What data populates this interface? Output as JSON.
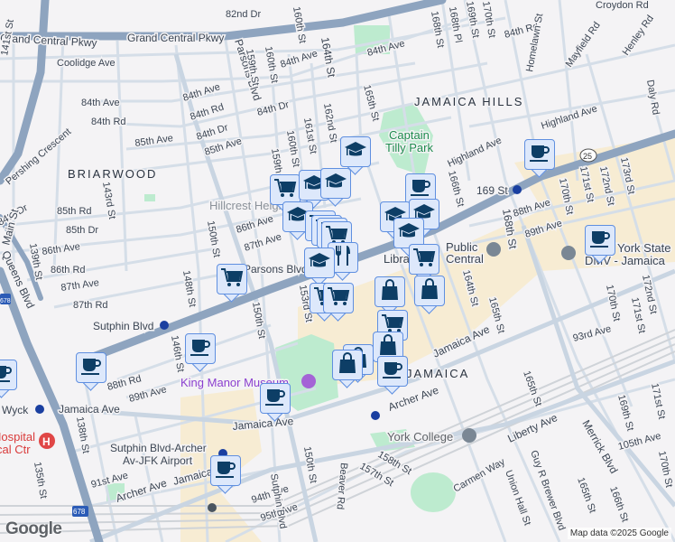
{
  "map": {
    "neighborhoods": {
      "briarwood": "BRIARWOOD",
      "jamaica_hills": "JAMAICA HILLS",
      "jamaica": "JAMAICA",
      "hillcrest": "Hillcrest Heights"
    },
    "parks": {
      "captain_tilly_line1": "Captain",
      "captain_tilly_line2": "Tilly Park"
    },
    "pois": {
      "king_manor": "King Manor Museum",
      "york_college": "York College",
      "library_line1": "Public",
      "library_line2": "Library",
      "library_line3": "Central",
      "dmv_line1": "York State",
      "dmv_line2": "DMV - Jamaica",
      "hospital_line1": "Hospital",
      "hospital_line2": "cal Ctr"
    },
    "stations": {
      "s169": "169 St",
      "sutphin": "Sutphin Blvd",
      "sutphin_archer_1": "Sutphin Blvd-Archer",
      "sutphin_archer_2": "Av-JFK Airport",
      "wyck": "Wyck",
      "jamaica_center": "Jamaica"
    },
    "roads": {
      "gcp1": "Grand Central Pkwy",
      "gcp2": "Grand Central Pkwy",
      "coolidge": "Coolidge Ave",
      "a84_1": "84th Ave",
      "a84_2": "84th Ave",
      "a84_3": "84th Ave",
      "a84_4": "84th Ave",
      "r84_1": "84th Rd",
      "r84_2": "84th Rd",
      "r84_3": "84th Rd",
      "d84_1": "84th Dr",
      "d84_2": "84th Dr",
      "d84_3": "84th Dr",
      "a85": "85th Ave",
      "a85b": "85th Ave",
      "r85": "85th Rd",
      "d85": "85th Dr",
      "a86": "86th Ave",
      "a86b": "86th Ave",
      "r86": "86th Rd",
      "a87": "87th Ave",
      "a87b": "87th Ave",
      "r87": "87th Rd",
      "r88": "88th Rd",
      "a89": "89th Ave",
      "a88e": "88th Ave",
      "a89e": "89th Ave",
      "a93": "93rd Ave",
      "a91": "91st Ave",
      "a94": "94th Ave",
      "a95": "95th Ave",
      "a105": "105th Ave",
      "parsons": "Parsons Blvd",
      "parsons2": "Parsons Blvd",
      "pershing": "Pershing Crescent",
      "highland1": "Highland Ave",
      "highland2": "Highland Ave",
      "homelawn": "Homelawn St",
      "mayfield": "Mayfield Rd",
      "henley": "Henley Rd",
      "daly": "Daly Rd",
      "croydon": "Croydon Rd",
      "d82": "82nd Dr",
      "jamaica1": "Jamaica Ave",
      "jamaica2": "Jamaica Ave",
      "jamaica3": "Jamaica Ave",
      "archer1": "Archer Ave",
      "archer2": "Archer Ave",
      "liberty": "Liberty Ave",
      "merrick": "Merrick Blvd",
      "guy": "Guy R Brewer Blvd",
      "union": "Union Hall St",
      "sutphin_blvd": "Sutphin Blvd",
      "beaver": "Beaver Rd",
      "carmen": "Carmen Way",
      "s141": "141st St",
      "s143": "143rd St",
      "s139": "139th St",
      "s138": "138th St",
      "s135": "135th St",
      "s146": "146th St",
      "s148": "148th St",
      "s150a": "150th St",
      "s150b": "150th St",
      "s150c": "150th St",
      "s153": "153rd St",
      "s157": "157th St",
      "s158": "158th St",
      "s159a": "159th St",
      "s159b": "159th St",
      "s160a": "160th St",
      "s160b": "160th St",
      "s160c": "160th St",
      "s161": "161st St",
      "s162": "162nd St",
      "s164": "164th St",
      "s164b": "164th St",
      "s165a": "165th St",
      "s165b": "165th St",
      "s165c": "165th St",
      "s165d": "165th St",
      "s166a": "166th St",
      "s166b": "166th St",
      "s168a": "168th St",
      "s168b": "168th St",
      "s168pl": "168th Pl",
      "s169a": "169th St",
      "s169b": "169th St",
      "s170a": "170th St",
      "s170b": "170th St",
      "s170c": "170th St",
      "s170d": "170th St",
      "s171a": "171st St",
      "s171b": "171st St",
      "s171c": "171st St",
      "s172a": "172nd St",
      "s172b": "172nd St",
      "s173": "173rd St",
      "main": "Main St",
      "queens": "Queens Blvd"
    },
    "shields": {
      "r25": "25",
      "i678a": "678",
      "i678b": "678"
    }
  },
  "markers": {
    "coffee": "coffee-icon",
    "school": "school-icon",
    "grocery": "cart-icon",
    "restaurant": "restaurant-icon",
    "shopping": "shopping-bag-icon"
  },
  "footer": {
    "logo": "Google",
    "copyright": "Map data ©2025 Google"
  },
  "colors": {
    "marker_fill": "#dde8fb",
    "marker_border": "#5f8fe0",
    "icon": "#0d3e66",
    "highway": "#8ea4bf",
    "park": "#bdebcf",
    "commercial": "#f7ecd3"
  }
}
